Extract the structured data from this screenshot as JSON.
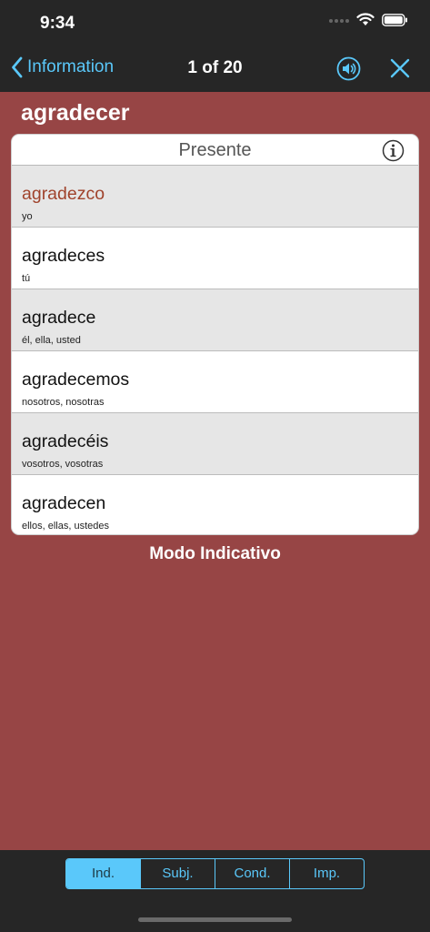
{
  "status_bar": {
    "time": "9:34"
  },
  "nav": {
    "back_label": "Information",
    "title": "1 of 20"
  },
  "verb": "agradecer",
  "tense": {
    "title": "Presente",
    "rows": [
      {
        "form": "agradezco",
        "pronoun": "yo"
      },
      {
        "form": "agradeces",
        "pronoun": "tú"
      },
      {
        "form": "agradece",
        "pronoun": "él, ella, usted"
      },
      {
        "form": "agradecemos",
        "pronoun": "nosotros, nosotras"
      },
      {
        "form": "agradecéis",
        "pronoun": "vosotros, vosotras"
      },
      {
        "form": "agradecen",
        "pronoun": "ellos, ellas, ustedes"
      }
    ]
  },
  "mood_label": "Modo Indicativo",
  "mood_tabs": [
    {
      "label": "Ind."
    },
    {
      "label": "Subj."
    },
    {
      "label": "Cond."
    },
    {
      "label": "Imp."
    }
  ],
  "icons": {
    "back": "chevron-left-icon",
    "speaker": "speaker-icon",
    "close": "close-icon",
    "info": "info-icon"
  },
  "colors": {
    "background": "#974545",
    "bar": "#262626",
    "accent": "#5ac8fa",
    "highlight_form": "#a0432c"
  }
}
